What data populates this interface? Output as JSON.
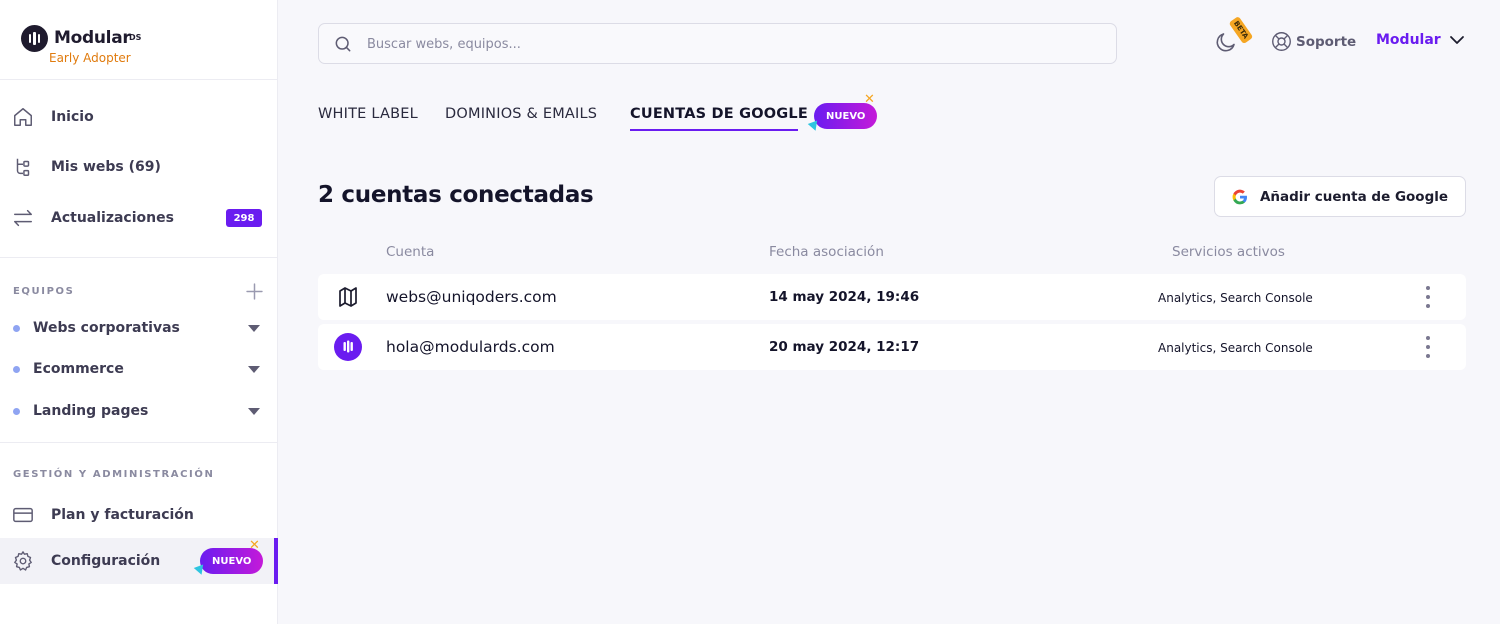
{
  "brand": {
    "name": "Modular",
    "suffix": "DS",
    "subtitle": "Early Adopter"
  },
  "sidebar": {
    "nav": [
      {
        "label": "Inicio",
        "icon": "home-icon"
      },
      {
        "label": "Mis webs (69)",
        "icon": "sitemap-icon"
      },
      {
        "label": "Actualizaciones",
        "icon": "arrows-exchange-icon",
        "badge": "298"
      }
    ],
    "teams_title": "EQUIPOS",
    "teams": [
      {
        "label": "Webs corporativas"
      },
      {
        "label": "Ecommerce"
      },
      {
        "label": "Landing pages"
      }
    ],
    "admin_title": "GESTIÓN Y ADMINISTRACIÓN",
    "admin": [
      {
        "label": "Plan y facturación",
        "icon": "credit-card-icon"
      },
      {
        "label": "Configuración",
        "icon": "gear-icon",
        "badge": "NUEVO",
        "active": true
      }
    ]
  },
  "topbar": {
    "search_placeholder": "Buscar webs, equipos...",
    "beta_label": "BETA",
    "support_label": "Soporte",
    "account_label": "Modular"
  },
  "tabs": [
    {
      "label": "WHITE LABEL"
    },
    {
      "label": "DOMINIOS & EMAILS"
    },
    {
      "label": "CUENTAS DE GOOGLE",
      "active": true,
      "badge": "NUEVO"
    }
  ],
  "header": {
    "title": "2 cuentas conectadas",
    "add_button": "Añadir cuenta de Google"
  },
  "table": {
    "columns": [
      "Cuenta",
      "Fecha asociación",
      "Servicios activos"
    ],
    "rows": [
      {
        "email": "webs@uniqoders.com",
        "date": "14 may 2024, 19:46",
        "services": "Analytics, Search Console",
        "avatar": "uniqoders-logo-icon"
      },
      {
        "email": "hola@modulards.com",
        "date": "20 may 2024, 12:17",
        "services": "Analytics, Search Console",
        "avatar": "modular-logo-icon"
      }
    ]
  },
  "colors": {
    "accent": "#6a1cf0",
    "accent_end": "#c41ad9",
    "brand_sub": "#e07b0e",
    "team_dot": "#8fa4f2"
  }
}
